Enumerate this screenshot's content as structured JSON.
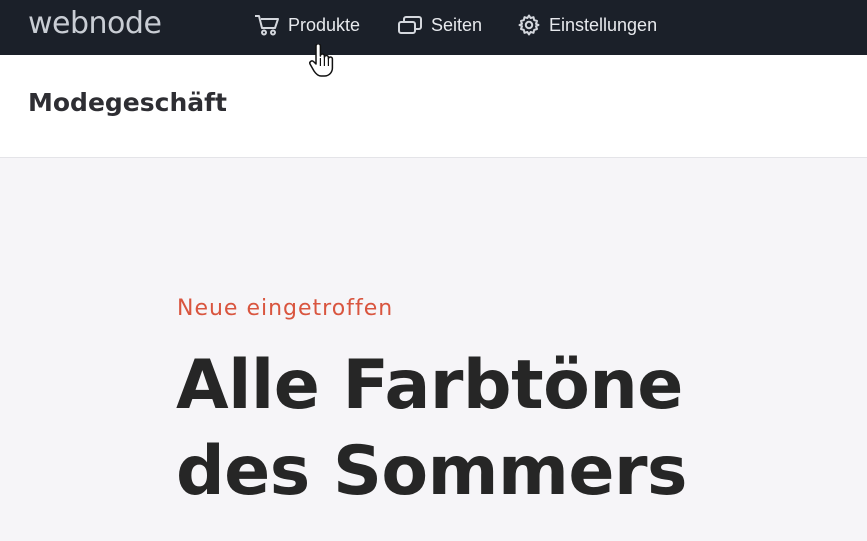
{
  "topbar": {
    "logo": "webnode",
    "nav": [
      {
        "label": "Produkte",
        "icon": "cart-icon"
      },
      {
        "label": "Seiten",
        "icon": "pages-icon"
      },
      {
        "label": "Einstellungen",
        "icon": "gear-icon"
      }
    ]
  },
  "site": {
    "title": "Modegeschäft"
  },
  "hero": {
    "eyebrow": "Neue eingetroffen",
    "headline_line1": "Alle Farbtöne",
    "headline_line2": "des Sommers"
  },
  "colors": {
    "topbar_bg": "#1b2029",
    "accent": "#d9553f",
    "hero_bg": "#f6f5f8",
    "headline": "#262626"
  }
}
